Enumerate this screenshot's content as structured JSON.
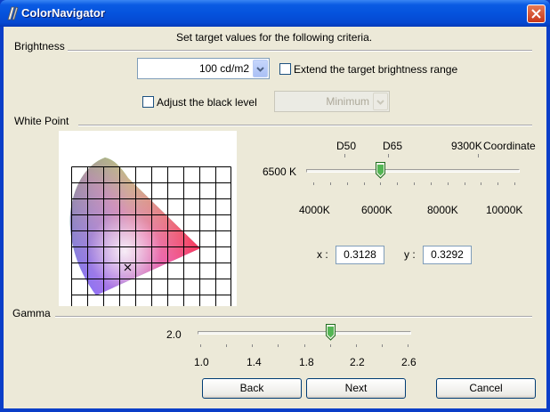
{
  "window": {
    "title": "ColorNavigator"
  },
  "instructions": "Set target values for the following criteria.",
  "brightness": {
    "section_label": "Brightness",
    "value": "100 cd/m2",
    "extend_label": "Extend the target brightness range",
    "adjust_black_label": "Adjust the black level",
    "black_level_value": "Minimum"
  },
  "white_point": {
    "section_label": "White Point",
    "top_labels": [
      "D50",
      "D65",
      "9300K",
      "Coordinate"
    ],
    "current_label": "6500 K",
    "scale_labels": [
      "4000K",
      "6000K",
      "8000K",
      "10000K"
    ],
    "x_label": "x :",
    "x_value": "0.3128",
    "y_label": "y :",
    "y_value": "0.3292",
    "slider_position": 0.33
  },
  "gamma": {
    "section_label": "Gamma",
    "current_label": "2.0",
    "scale_labels": [
      "1.0",
      "1.4",
      "1.8",
      "2.2",
      "2.6"
    ],
    "slider_position": 0.625
  },
  "buttons": {
    "back": "Back",
    "next": "Next",
    "cancel": "Cancel"
  },
  "colors": {
    "title_bar": "#0553dd",
    "dialog_bg": "#ece9d8",
    "close_button": "#c8371a"
  }
}
